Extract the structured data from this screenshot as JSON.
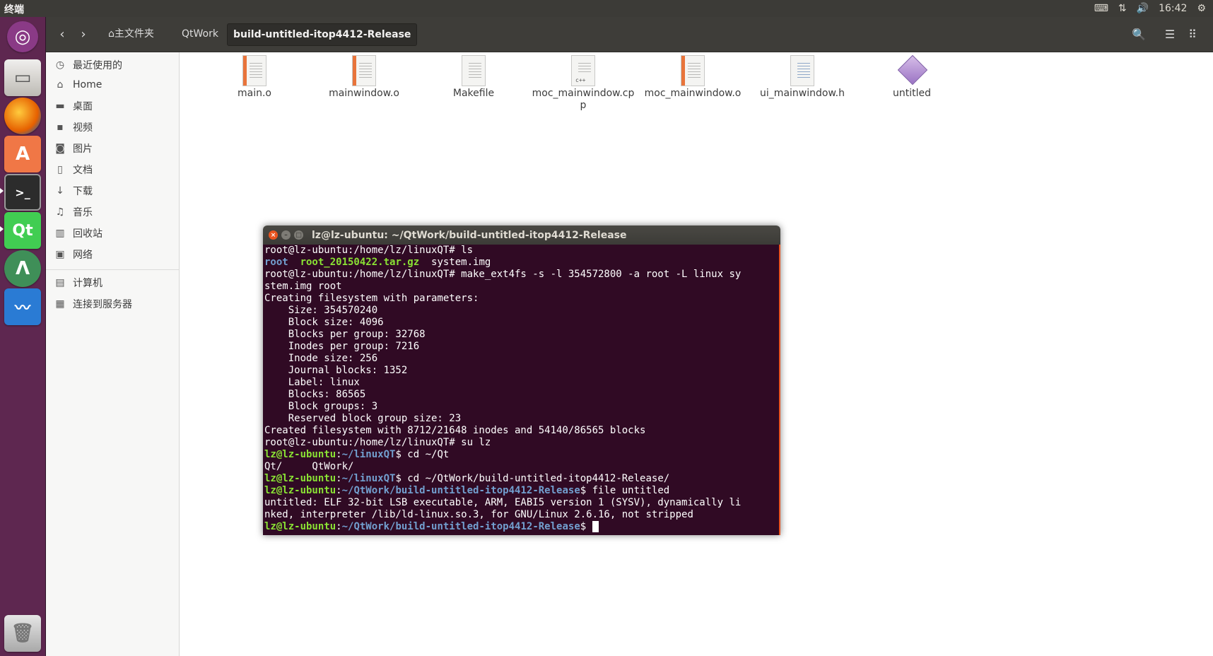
{
  "topbar": {
    "title": "终端",
    "indicators": {
      "keyboard_icon": "keyboard-icon",
      "network_icon": "network-arrows-icon",
      "volume_icon": "volume-icon",
      "time": "16:42",
      "power_icon": "gear-icon"
    }
  },
  "launcher": {
    "items": [
      {
        "name": "ubuntu-dash",
        "icon": "ubuntu-logo-icon",
        "color": "#8a3a86"
      },
      {
        "name": "files",
        "icon": "file-cabinet-icon",
        "color": "#d35f2e"
      },
      {
        "name": "firefox",
        "icon": "firefox-icon",
        "color": "#e66000"
      },
      {
        "name": "software-center",
        "icon": "software-center-icon",
        "color": "#f07746"
      },
      {
        "name": "terminal",
        "icon": "terminal-icon",
        "color": "#2c2c2c"
      },
      {
        "name": "qt-creator",
        "icon": "qt-icon",
        "color": "#41cd52",
        "label": "Qt"
      },
      {
        "name": "android-studio",
        "icon": "android-studio-icon",
        "color": "#3f8f58"
      },
      {
        "name": "system-monitor",
        "icon": "system-monitor-icon",
        "color": "#2a7bd4"
      },
      {
        "name": "trash",
        "icon": "trash-icon",
        "color": "#b9b9b9"
      }
    ]
  },
  "header": {
    "back_icon": "chevron-left-icon",
    "forward_icon": "chevron-right-icon",
    "breadcrumbs": [
      {
        "label": "主文件夹",
        "icon": "home-icon"
      },
      {
        "label": "QtWork"
      },
      {
        "label": "build-untitled-itop4412-Release",
        "active": true
      }
    ],
    "search_icon": "search-icon",
    "list_icon": "list-view-icon",
    "grid_icon": "grid-view-icon"
  },
  "sidebar": {
    "items": [
      {
        "label": "最近使用的",
        "icon": "clock-icon"
      },
      {
        "label": "Home",
        "icon": "home-icon"
      },
      {
        "label": "桌面",
        "icon": "folder-icon"
      },
      {
        "label": "视频",
        "icon": "video-icon"
      },
      {
        "label": "图片",
        "icon": "camera-icon"
      },
      {
        "label": "文档",
        "icon": "document-icon"
      },
      {
        "label": "下载",
        "icon": "download-icon"
      },
      {
        "label": "音乐",
        "icon": "music-icon"
      },
      {
        "label": "回收站",
        "icon": "trash-icon"
      },
      {
        "label": "网络",
        "icon": "network-icon"
      }
    ],
    "devices": [
      {
        "label": "计算机",
        "icon": "computer-icon"
      },
      {
        "label": "连接到服务器",
        "icon": "server-icon"
      }
    ]
  },
  "files": [
    {
      "name": "main.o",
      "type": "object"
    },
    {
      "name": "mainwindow.o",
      "type": "object"
    },
    {
      "name": "Makefile",
      "type": "text"
    },
    {
      "name": "moc_mainwindow.cpp",
      "type": "cpp",
      "badge": "c++"
    },
    {
      "name": "moc_mainwindow.o",
      "type": "object"
    },
    {
      "name": "ui_mainwindow.h",
      "type": "header"
    },
    {
      "name": "untitled",
      "type": "executable"
    }
  ],
  "terminal": {
    "title": "lz@lz-ubuntu: ~/QtWork/build-untitled-itop4412-Release",
    "close_icon": "close-icon",
    "minimize_icon": "minimize-icon",
    "maximize_icon": "maximize-icon",
    "lines": [
      [
        {
          "t": "root@lz-ubuntu:/home/lz/linuxQT# ls",
          "c": ""
        }
      ],
      [
        {
          "t": "root",
          "c": "d"
        },
        {
          "t": "  ",
          "c": ""
        },
        {
          "t": "root_20150422.tar.gz",
          "c": "g"
        },
        {
          "t": "  system.img",
          "c": ""
        }
      ],
      [
        {
          "t": "root@lz-ubuntu:/home/lz/linuxQT# make_ext4fs -s -l 354572800 -a root -L linux sy",
          "c": ""
        }
      ],
      [
        {
          "t": "stem.img root",
          "c": ""
        }
      ],
      [
        {
          "t": "Creating filesystem with parameters:",
          "c": ""
        }
      ],
      [
        {
          "t": "    Size: 354570240",
          "c": ""
        }
      ],
      [
        {
          "t": "    Block size: 4096",
          "c": ""
        }
      ],
      [
        {
          "t": "    Blocks per group: 32768",
          "c": ""
        }
      ],
      [
        {
          "t": "    Inodes per group: 7216",
          "c": ""
        }
      ],
      [
        {
          "t": "    Inode size: 256",
          "c": ""
        }
      ],
      [
        {
          "t": "    Journal blocks: 1352",
          "c": ""
        }
      ],
      [
        {
          "t": "    Label: linux",
          "c": ""
        }
      ],
      [
        {
          "t": "    Blocks: 86565",
          "c": ""
        }
      ],
      [
        {
          "t": "    Block groups: 3",
          "c": ""
        }
      ],
      [
        {
          "t": "    Reserved block group size: 23",
          "c": ""
        }
      ],
      [
        {
          "t": "Created filesystem with 8712/21648 inodes and 54140/86565 blocks",
          "c": ""
        }
      ],
      [
        {
          "t": "root@lz-ubuntu:/home/lz/linuxQT# su lz",
          "c": ""
        }
      ],
      [
        {
          "t": "lz@lz-ubuntu",
          "c": "u"
        },
        {
          "t": ":",
          "c": ""
        },
        {
          "t": "~/linuxQT",
          "c": "p"
        },
        {
          "t": "$ cd ~/Qt",
          "c": ""
        }
      ],
      [
        {
          "t": "Qt/     QtWork/",
          "c": ""
        }
      ],
      [
        {
          "t": "lz@lz-ubuntu",
          "c": "u"
        },
        {
          "t": ":",
          "c": ""
        },
        {
          "t": "~/linuxQT",
          "c": "p"
        },
        {
          "t": "$ cd ~/QtWork/build-untitled-itop4412-Release/",
          "c": ""
        }
      ],
      [
        {
          "t": "lz@lz-ubuntu",
          "c": "u"
        },
        {
          "t": ":",
          "c": ""
        },
        {
          "t": "~/QtWork/build-untitled-itop4412-Release",
          "c": "p"
        },
        {
          "t": "$ file untitled",
          "c": ""
        }
      ],
      [
        {
          "t": "untitled: ELF 32-bit LSB executable, ARM, EABI5 version 1 (SYSV), dynamically li",
          "c": ""
        }
      ],
      [
        {
          "t": "nked, interpreter /lib/ld-linux.so.3, for GNU/Linux 2.6.16, not stripped",
          "c": ""
        }
      ],
      [
        {
          "t": "lz@lz-ubuntu",
          "c": "u"
        },
        {
          "t": ":",
          "c": ""
        },
        {
          "t": "~/QtWork/build-untitled-itop4412-Release",
          "c": "p"
        },
        {
          "t": "$ ",
          "c": ""
        },
        {
          "cursor": true
        }
      ]
    ]
  },
  "colors": {
    "launcher_bg": "#5e2750",
    "terminal_bg": "#300a24",
    "prompt_user": "#8ae234",
    "prompt_path": "#729fcf",
    "accent": "#e95420"
  }
}
